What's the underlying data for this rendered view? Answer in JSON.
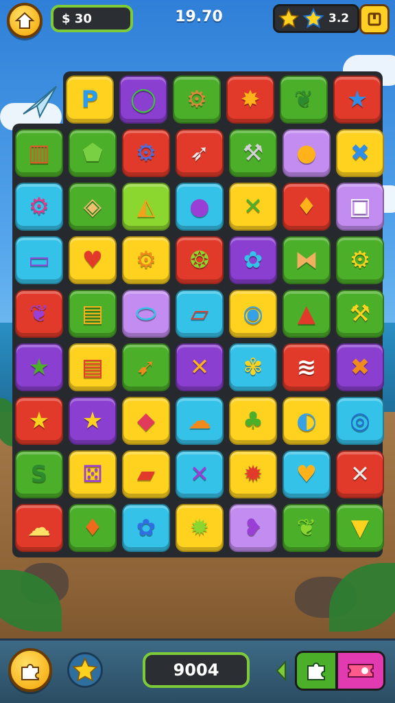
{
  "header": {
    "coins_label": "$ 30",
    "score_label": "19.70",
    "stars_value": "3.2"
  },
  "footer": {
    "score_value": "9004"
  },
  "colors": {
    "yellow": "#ffd21f",
    "purple": "#8a3fd1",
    "green": "#4caf2a",
    "red": "#e23a2a",
    "blue": "#35c2e8",
    "lilac": "#c38cf0",
    "lime": "#8bd62f"
  },
  "board": {
    "top_row": [
      {
        "color": "yellow",
        "icon": "letter-p-icon",
        "glyph": "P",
        "fg": "#2a9cf0"
      },
      {
        "color": "purple",
        "icon": "ring-icon",
        "glyph": "◯",
        "fg": "#3ec43e"
      },
      {
        "color": "green",
        "icon": "gear-icon",
        "glyph": "⚙",
        "fg": "#d9893a"
      },
      {
        "color": "red",
        "icon": "splat-icon",
        "glyph": "✸",
        "fg": "#ffb21a"
      },
      {
        "color": "green",
        "icon": "feather-icon",
        "glyph": "❦",
        "fg": "#2e8a2e"
      },
      {
        "color": "red",
        "icon": "star-icon",
        "glyph": "★",
        "fg": "#2f8fe8"
      }
    ],
    "rows": [
      [
        {
          "color": "green",
          "icon": "book-icon",
          "glyph": "▥",
          "fg": "#e6552a"
        },
        {
          "color": "green",
          "icon": "speech-bubble-icon",
          "glyph": "⬟",
          "fg": "#7ad043"
        },
        {
          "color": "red",
          "icon": "gear-icon",
          "glyph": "⚙",
          "fg": "#4a6ee0"
        },
        {
          "color": "red",
          "icon": "rocket-icon",
          "glyph": "➶",
          "fg": "#e8e8e8"
        },
        {
          "color": "green",
          "icon": "brush-icon",
          "glyph": "⚒",
          "fg": "#d0d0d0"
        },
        {
          "color": "lilac",
          "icon": "orange-ball-icon",
          "glyph": "●",
          "fg": "#ffb21a"
        },
        {
          "color": "yellow",
          "icon": "cross-icon",
          "glyph": "✖",
          "fg": "#2f8fe8"
        }
      ],
      [
        {
          "color": "blue",
          "icon": "gear-icon",
          "glyph": "⚙",
          "fg": "#e23a8a"
        },
        {
          "color": "green",
          "icon": "cube-icon",
          "glyph": "◈",
          "fg": "#f0c070"
        },
        {
          "color": "lime",
          "icon": "pizza-icon",
          "glyph": "◭",
          "fg": "#f4a21d"
        },
        {
          "color": "blue",
          "icon": "purple-ball-icon",
          "glyph": "●",
          "fg": "#9a3fd6"
        },
        {
          "color": "yellow",
          "icon": "crossed-tools-icon",
          "glyph": "✕",
          "fg": "#4caf2a"
        },
        {
          "color": "red",
          "icon": "drop-icon",
          "glyph": "♦",
          "fg": "#ffb21a"
        },
        {
          "color": "lilac",
          "icon": "window-icon",
          "glyph": "▣",
          "fg": "#ffffff"
        }
      ],
      [
        {
          "color": "blue",
          "icon": "candy-icon",
          "glyph": "▭",
          "fg": "#9a3fd6"
        },
        {
          "color": "yellow",
          "icon": "heart-icon",
          "glyph": "♥",
          "fg": "#e23a2a"
        },
        {
          "color": "yellow",
          "icon": "gear-icon",
          "glyph": "⚙",
          "fg": "#f08a1d"
        },
        {
          "color": "red",
          "icon": "leaf-icon",
          "glyph": "❂",
          "fg": "#8bd62f"
        },
        {
          "color": "purple",
          "icon": "blob-icon",
          "glyph": "✿",
          "fg": "#35c2e8"
        },
        {
          "color": "green",
          "icon": "bow-icon",
          "glyph": "⧓",
          "fg": "#f0b060"
        },
        {
          "color": "green",
          "icon": "gear-icon",
          "glyph": "⚙",
          "fg": "#ffd21f"
        }
      ],
      [
        {
          "color": "red",
          "icon": "feather-icon",
          "glyph": "❦",
          "fg": "#9a3fd6"
        },
        {
          "color": "green",
          "icon": "box-icon",
          "glyph": "▤",
          "fg": "#ffb21a"
        },
        {
          "color": "lilac",
          "icon": "popsicle-icon",
          "glyph": "⬭",
          "fg": "#35c2e8"
        },
        {
          "color": "blue",
          "icon": "frame-icon",
          "glyph": "▱",
          "fg": "#e23a2a"
        },
        {
          "color": "yellow",
          "icon": "planet-icon",
          "glyph": "◉",
          "fg": "#35a2e8"
        },
        {
          "color": "green",
          "icon": "cone-icon",
          "glyph": "▲",
          "fg": "#e23a2a"
        },
        {
          "color": "green",
          "icon": "pickaxe-icon",
          "glyph": "⚒",
          "fg": "#ffd21f"
        }
      ],
      [
        {
          "color": "purple",
          "icon": "star-card-icon",
          "glyph": "★",
          "fg": "#4caf2a"
        },
        {
          "color": "yellow",
          "icon": "cake-icon",
          "glyph": "▤",
          "fg": "#e23a2a"
        },
        {
          "color": "green",
          "icon": "torch-icon",
          "glyph": "➹",
          "fg": "#f08a1d"
        },
        {
          "color": "purple",
          "icon": "swords-icon",
          "glyph": "✕",
          "fg": "#ffb21a"
        },
        {
          "color": "blue",
          "icon": "flower-icon",
          "glyph": "✾",
          "fg": "#ffd21f"
        },
        {
          "color": "red",
          "icon": "stripes-icon",
          "glyph": "≋",
          "fg": "#ffffff"
        },
        {
          "color": "purple",
          "icon": "bandage-icon",
          "glyph": "✖",
          "fg": "#f08a1d"
        }
      ],
      [
        {
          "color": "red",
          "icon": "star-icon",
          "glyph": "★",
          "fg": "#ffd21f"
        },
        {
          "color": "purple",
          "icon": "star-icon",
          "glyph": "★",
          "fg": "#ffd21f"
        },
        {
          "color": "yellow",
          "icon": "kite-icon",
          "glyph": "◆",
          "fg": "#e23a5a"
        },
        {
          "color": "blue",
          "icon": "cloud-icon",
          "glyph": "☁",
          "fg": "#f08a1d"
        },
        {
          "color": "yellow",
          "icon": "clover-icon",
          "glyph": "♣",
          "fg": "#4caf2a"
        },
        {
          "color": "yellow",
          "icon": "compass-icon",
          "glyph": "◐",
          "fg": "#35a2e8"
        },
        {
          "color": "blue",
          "icon": "spiral-icon",
          "glyph": "◎",
          "fg": "#1f6fd0"
        }
      ],
      [
        {
          "color": "green",
          "icon": "snake-icon",
          "glyph": "S",
          "fg": "#2e8a2e"
        },
        {
          "color": "yellow",
          "icon": "dice-icon",
          "glyph": "⚄",
          "fg": "#9a3fd6"
        },
        {
          "color": "yellow",
          "icon": "folder-icon",
          "glyph": "▰",
          "fg": "#e23a2a"
        },
        {
          "color": "blue",
          "icon": "crossed-wands-icon",
          "glyph": "✕",
          "fg": "#9a3fd6"
        },
        {
          "color": "yellow",
          "icon": "sun-icon",
          "glyph": "✹",
          "fg": "#e23a2a"
        },
        {
          "color": "blue",
          "icon": "heart-shield-icon",
          "glyph": "♥",
          "fg": "#ffb21a"
        },
        {
          "color": "red",
          "icon": "swords-icon",
          "glyph": "✕",
          "fg": "#e8e8e8"
        }
      ],
      [
        {
          "color": "red",
          "icon": "cloud-icon",
          "glyph": "☁",
          "fg": "#ffe066"
        },
        {
          "color": "green",
          "icon": "carrot-icon",
          "glyph": "♦",
          "fg": "#f06a1d"
        },
        {
          "color": "blue",
          "icon": "flower-icon",
          "glyph": "✿",
          "fg": "#2f6fe0"
        },
        {
          "color": "yellow",
          "icon": "sun-icon",
          "glyph": "✹",
          "fg": "#8bd62f"
        },
        {
          "color": "lilac",
          "icon": "chat-icon",
          "glyph": "❥",
          "fg": "#9a3fd6"
        },
        {
          "color": "green",
          "icon": "leaf-icon",
          "glyph": "❦",
          "fg": "#8bd62f"
        },
        {
          "color": "green",
          "icon": "ice-cream-icon",
          "glyph": "▼",
          "fg": "#ffd21f"
        }
      ]
    ]
  }
}
